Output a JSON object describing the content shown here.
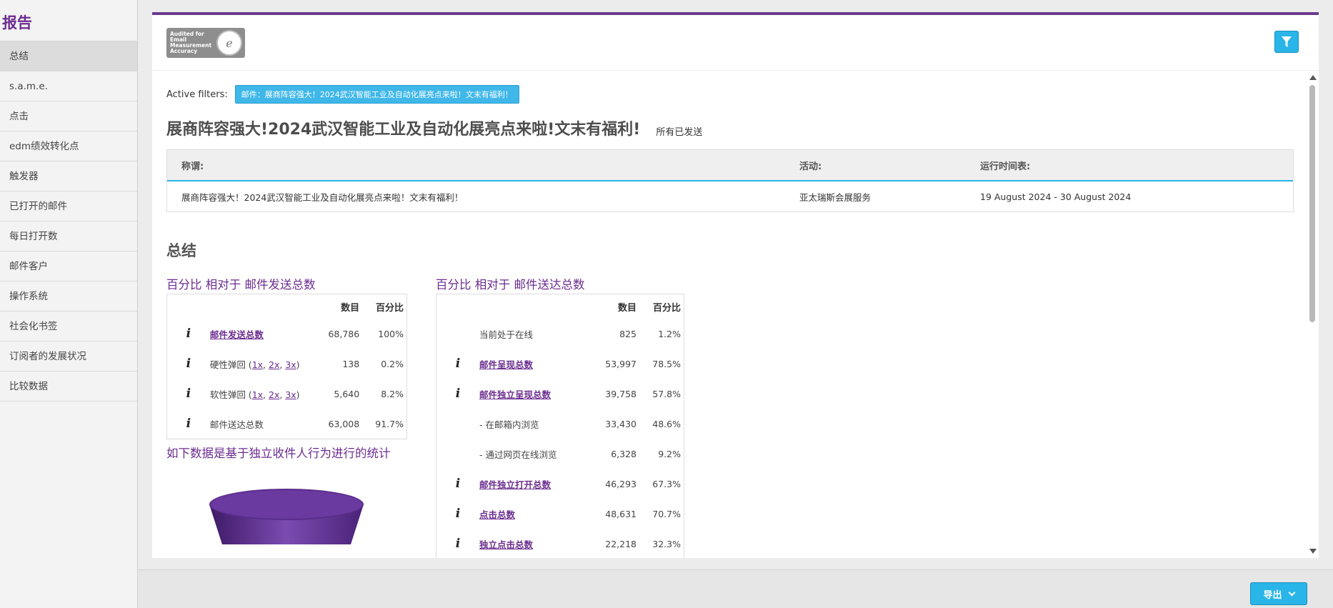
{
  "sidebar": {
    "title": "报告",
    "items": [
      {
        "label": "总结",
        "active": true
      },
      {
        "label": "s.a.m.e."
      },
      {
        "label": "点击"
      },
      {
        "label": "edm绩效转化点"
      },
      {
        "label": "触发器"
      },
      {
        "label": "已打开的邮件"
      },
      {
        "label": "每日打开数"
      },
      {
        "label": "邮件客户"
      },
      {
        "label": "操作系统"
      },
      {
        "label": "社会化书签"
      },
      {
        "label": "订阅者的发展状况"
      },
      {
        "label": "比较数据"
      }
    ]
  },
  "header": {
    "logo_text": [
      "Audited for",
      "Email",
      "Measurement",
      "Accuracy"
    ],
    "filter_icon": "funnel-icon"
  },
  "filters": {
    "label": "Active filters:",
    "chip": "邮件：展商阵容强大！2024武汉智能工业及自动化展亮点来啦！文末有福利！"
  },
  "campaign": {
    "title": "展商阵容强大!2024武汉智能工业及自动化展亮点来啦!文末有福利!",
    "status": "所有已发送"
  },
  "info_table": {
    "headers": [
      "称谓:",
      "活动:",
      "运行时间表:"
    ],
    "row": [
      "展商阵容强大！2024武汉智能工业及自动化展亮点来啦！文末有福利！",
      "亚太瑞斯会展服务",
      "19 August 2024 - 30 August 2024"
    ]
  },
  "summary": {
    "title": "总结",
    "left": {
      "caption": "百分比 相对于 邮件发送总数",
      "headers": [
        "数目",
        "百分比"
      ],
      "rows": [
        {
          "label": "邮件发送总数",
          "num": "68,786",
          "pct": "100%",
          "info": true,
          "link": true
        },
        {
          "label": "硬性弹回",
          "mult": [
            "1x",
            "2x",
            "3x"
          ],
          "num": "138",
          "pct": "0.2%",
          "info": true
        },
        {
          "label": "软性弹回",
          "mult": [
            "1x",
            "2x",
            "3x"
          ],
          "num": "5,640",
          "pct": "8.2%",
          "info": true
        },
        {
          "label": "邮件送达总数",
          "num": "63,008",
          "pct": "91.7%",
          "info": true
        }
      ]
    },
    "right": {
      "caption": "百分比 相对于 邮件送达总数",
      "headers": [
        "数目",
        "百分比"
      ],
      "rows": [
        {
          "label": "当前处于在线",
          "num": "825",
          "pct": "1.2%",
          "info": false
        },
        {
          "label": "邮件呈现总数",
          "num": "53,997",
          "pct": "78.5%",
          "info": true,
          "link": true
        },
        {
          "label": "邮件独立呈现总数",
          "num": "39,758",
          "pct": "57.8%",
          "info": true,
          "link": true
        },
        {
          "label": "- 在邮箱内浏览",
          "num": "33,430",
          "pct": "48.6%",
          "info": false
        },
        {
          "label": "- 通过网页在线浏览",
          "num": "6,328",
          "pct": "9.2%",
          "info": false
        },
        {
          "label": "邮件独立打开总数",
          "num": "46,293",
          "pct": "67.3%",
          "info": true,
          "link": true
        },
        {
          "label": "点击总数",
          "num": "48,631",
          "pct": "70.7%",
          "info": true,
          "link": true
        },
        {
          "label": "独立点击总数",
          "num": "22,218",
          "pct": "32.3%",
          "info": true,
          "link": true
        }
      ]
    },
    "unique_caption": "如下数据是基于独立收件人行为进行的统计"
  },
  "footer": {
    "export_label": "导出"
  },
  "colors": {
    "accent_purple": "#6b2d8f",
    "accent_blue": "#29b5e8"
  }
}
